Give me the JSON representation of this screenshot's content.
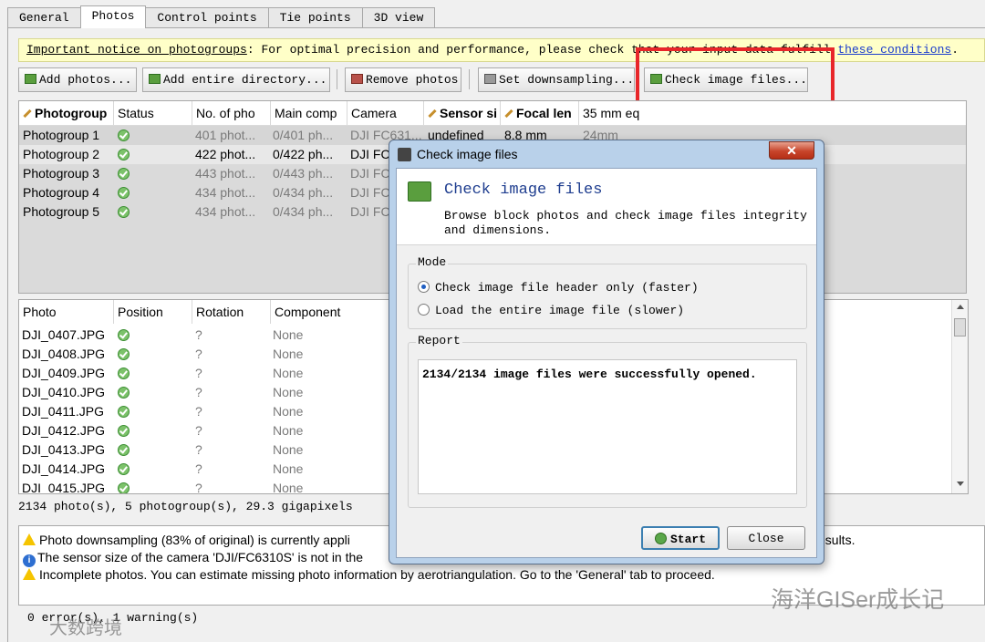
{
  "tabs": [
    "General",
    "Photos",
    "Control points",
    "Tie points",
    "3D view"
  ],
  "notice": {
    "link1": "Important notice on photogroups",
    "text": ": For optimal precision and performance, please check that your input data fulfill ",
    "link2": "these conditions",
    "end": "."
  },
  "toolbar": {
    "add_photos": "Add photos...",
    "add_dir": "Add entire directory...",
    "remove": "Remove photos",
    "downsampling": "Set downsampling...",
    "check": "Check image files..."
  },
  "groups_table": {
    "headers": [
      "Photogroup",
      "Status",
      "No. of pho",
      "Main comp",
      "Camera",
      "Sensor si",
      "Focal len",
      "35 mm eq"
    ],
    "rows": [
      {
        "name": "Photogroup 1",
        "photos": "401 phot...",
        "comp": "0/401 ph...",
        "camera": "DJI FC631...",
        "sensor": "undefined",
        "focal": "8.8 mm",
        "eq": "24mm"
      },
      {
        "name": "Photogroup 2",
        "photos": "422 phot...",
        "comp": "0/422 ph...",
        "camera": "DJI FC",
        "sensor": "",
        "focal": "",
        "eq": ""
      },
      {
        "name": "Photogroup 3",
        "photos": "443 phot...",
        "comp": "0/443 ph...",
        "camera": "DJI FC",
        "sensor": "",
        "focal": "",
        "eq": ""
      },
      {
        "name": "Photogroup 4",
        "photos": "434 phot...",
        "comp": "0/434 ph...",
        "camera": "DJI FC",
        "sensor": "",
        "focal": "",
        "eq": ""
      },
      {
        "name": "Photogroup 5",
        "photos": "434 phot...",
        "comp": "0/434 ph...",
        "camera": "DJI FC",
        "sensor": "",
        "focal": "",
        "eq": ""
      }
    ]
  },
  "photos_table": {
    "headers": [
      "Photo",
      "Position",
      "Rotation",
      "Component"
    ],
    "rows": [
      {
        "photo": "DJI_0407.JPG",
        "rotation": "?",
        "component": "None"
      },
      {
        "photo": "DJI_0408.JPG",
        "rotation": "?",
        "component": "None"
      },
      {
        "photo": "DJI_0409.JPG",
        "rotation": "?",
        "component": "None"
      },
      {
        "photo": "DJI_0410.JPG",
        "rotation": "?",
        "component": "None"
      },
      {
        "photo": "DJI_0411.JPG",
        "rotation": "?",
        "component": "None"
      },
      {
        "photo": "DJI_0412.JPG",
        "rotation": "?",
        "component": "None"
      },
      {
        "photo": "DJI_0413.JPG",
        "rotation": "?",
        "component": "None"
      },
      {
        "photo": "DJI_0414.JPG",
        "rotation": "?",
        "component": "None"
      },
      {
        "photo": "DJI_0415.JPG",
        "rotation": "?",
        "component": "None"
      }
    ]
  },
  "summary": "2134 photo(s), 5 photogroup(s), 29.3 gigapixels",
  "messages": [
    {
      "icon": "warning-icon",
      "text": "Photo downsampling (83% of original) is currently appli",
      "tail": "esults."
    },
    {
      "icon": "info-icon",
      "text": "The sensor size of the camera 'DJI/FC6310S' is not in the",
      "tail": ""
    },
    {
      "icon": "warning-icon",
      "text": "Incomplete photos. You can estimate missing photo information by aerotriangulation. Go to the 'General' tab to proceed.",
      "tail": ""
    }
  ],
  "errors": "0 error(s), 1 warning(s)",
  "dialog": {
    "title": "Check image files",
    "close_x": "✕",
    "heading": "Check image files",
    "description": "Browse block photos and check image files integrity and dimensions.",
    "mode_label": "Mode",
    "option1": "Check image file header only (faster)",
    "option2": "Load the entire image file (slower)",
    "report_label": "Report",
    "report_text": "2134/2134 image files were successfully opened.",
    "start": "Start",
    "close": "Close"
  },
  "watermark": {
    "right": "海洋GISer成长记",
    "left": "大数跨境"
  }
}
